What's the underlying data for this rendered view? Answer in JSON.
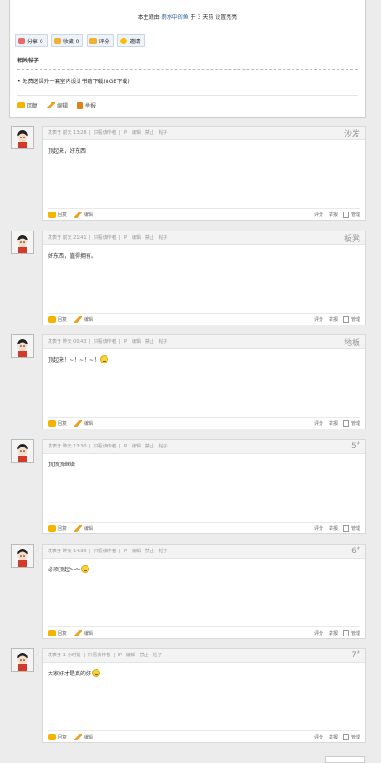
{
  "thread": {
    "highlight_prefix": "本主题由",
    "highlight_name": "雨水中的鱼",
    "highlight_mid": "于",
    "highlight_days": "3",
    "highlight_suffix": "天前 设置亮亮",
    "share_buttons": [
      {
        "label": "分享 0",
        "icon": "share-icon",
        "color": "#e86a6a"
      },
      {
        "label": "收藏 0",
        "icon": "star-icon",
        "color": "#f0b030"
      },
      {
        "label": "评分",
        "icon": "thumb-icon",
        "color": "#f0b030"
      },
      {
        "label": "邀请",
        "icon": "invite-icon",
        "color": "#f5c000"
      }
    ],
    "related_title": "相关帖子",
    "related_items": [
      "• 免费送课外一套室内设计书籍下载(8GB下载)"
    ],
    "actions": {
      "reply": "回复",
      "edit": "编辑",
      "report": "举报"
    }
  },
  "post_labels": {
    "only_author": "只看该作者",
    "ip": "IP",
    "edit": "编辑",
    "ban": "禁止",
    "post": "帖子",
    "reply": "回复",
    "rate": "评分",
    "report": "举报",
    "manage": "管理"
  },
  "posts": [
    {
      "meta": "发表于 前天 13:28",
      "floor": "沙发",
      "floor_sup": "",
      "content": "顶起来，好东西",
      "smiley": false
    },
    {
      "meta": "发表于 前天 21:41",
      "floor": "板凳",
      "floor_sup": "",
      "content": "好东西，值得拥有。",
      "smiley": false
    },
    {
      "meta": "发表于 昨天 00:43",
      "floor": "地板",
      "floor_sup": "",
      "content": "顶起来！~！~！~！",
      "smiley": true
    },
    {
      "meta": "发表于 昨天 13:30",
      "floor": "5",
      "floor_sup": "#",
      "content": "顶顶顶继续",
      "smiley": false
    },
    {
      "meta": "发表于 昨天 14:30",
      "floor": "6",
      "floor_sup": "#",
      "content": "必须顶起～～",
      "smiley": true
    },
    {
      "meta": "发表于 1 小时前",
      "floor": "7",
      "floor_sup": "#",
      "content": "大家好才是真的好",
      "smiley": true
    }
  ]
}
